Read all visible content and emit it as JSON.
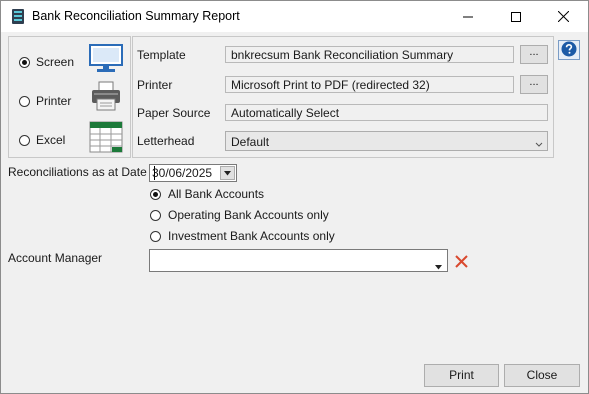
{
  "window": {
    "title": "Bank Reconciliation Summary Report"
  },
  "output": {
    "options": [
      {
        "label": "Screen",
        "selected": true
      },
      {
        "label": "Printer",
        "selected": false
      },
      {
        "label": "Excel",
        "selected": false
      }
    ]
  },
  "settings": {
    "template_label": "Template",
    "template_value": "bnkrecsum Bank Reconciliation Summary",
    "printer_label": "Printer",
    "printer_value": "Microsoft Print to PDF (redirected 32)",
    "paper_source_label": "Paper Source",
    "paper_source_value": "Automatically Select",
    "letterhead_label": "Letterhead",
    "letterhead_value": "Default",
    "browse_label": "..."
  },
  "form": {
    "date_label": "Reconciliations as at Date",
    "date_value": "30/06/2025",
    "account_options": [
      {
        "label": "All Bank Accounts",
        "selected": true
      },
      {
        "label": "Operating Bank Accounts only",
        "selected": false
      },
      {
        "label": "Investment Bank Accounts only",
        "selected": false
      }
    ],
    "manager_label": "Account Manager",
    "manager_value": ""
  },
  "buttons": {
    "print": "Print",
    "close": "Close"
  },
  "icons": {
    "help": "help-icon",
    "clear": "clear-x-icon",
    "screen": "monitor-icon",
    "printer": "printer-icon",
    "excel": "spreadsheet-icon"
  },
  "colors": {
    "clear_x": "#d9492e",
    "help": "#1c5aa6",
    "excel_green": "#1d7a3a",
    "monitor_blue": "#2b6cb8"
  }
}
